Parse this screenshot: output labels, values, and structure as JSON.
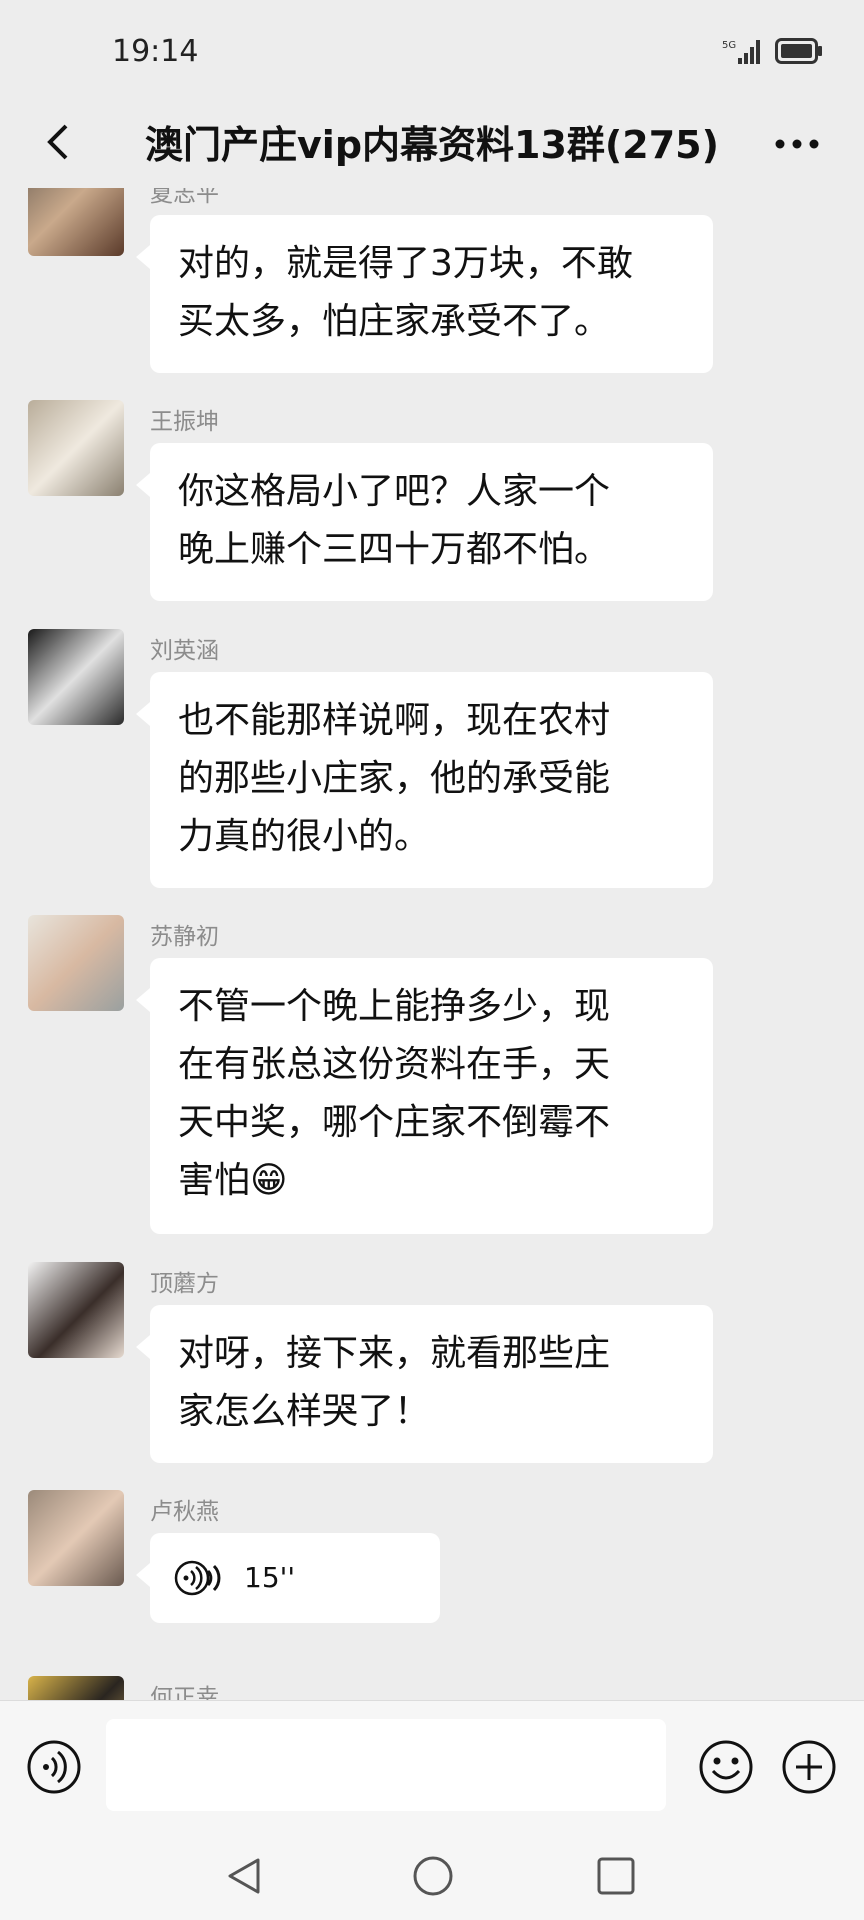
{
  "status_bar": {
    "time": "19:14",
    "network": "5G"
  },
  "header": {
    "title": "澳门产庄vip内幕资料13群(275)"
  },
  "messages": [
    {
      "sender": "夏志平",
      "lines": [
        "对的，就是得了3万块，不敢",
        "买太多，怕庄家承受不了。"
      ]
    },
    {
      "sender": "王振坤",
      "lines": [
        "你这格局小了吧？人家一个",
        "晚上赚个三四十万都不怕。"
      ]
    },
    {
      "sender": "刘英涵",
      "lines": [
        "也不能那样说啊，现在农村",
        "的那些小庄家，他的承受能",
        "力真的很小的。"
      ]
    },
    {
      "sender": "苏静初",
      "lines": [
        "不管一个晚上能挣多少，现",
        "在有张总这份资料在手，天",
        "天中奖，哪个庄家不倒霉不",
        "害怕😁"
      ]
    },
    {
      "sender": "顶蘑方",
      "lines": [
        "对呀，接下来，就看那些庄",
        "家怎么样哭了！"
      ]
    },
    {
      "sender": "卢秋燕",
      "voice_duration": "15''"
    },
    {
      "sender": "何正幸"
    }
  ],
  "input": {
    "placeholder": ""
  },
  "colors": {
    "background": "#ededed",
    "bubble": "#ffffff",
    "sender": "#8c8c8c"
  }
}
